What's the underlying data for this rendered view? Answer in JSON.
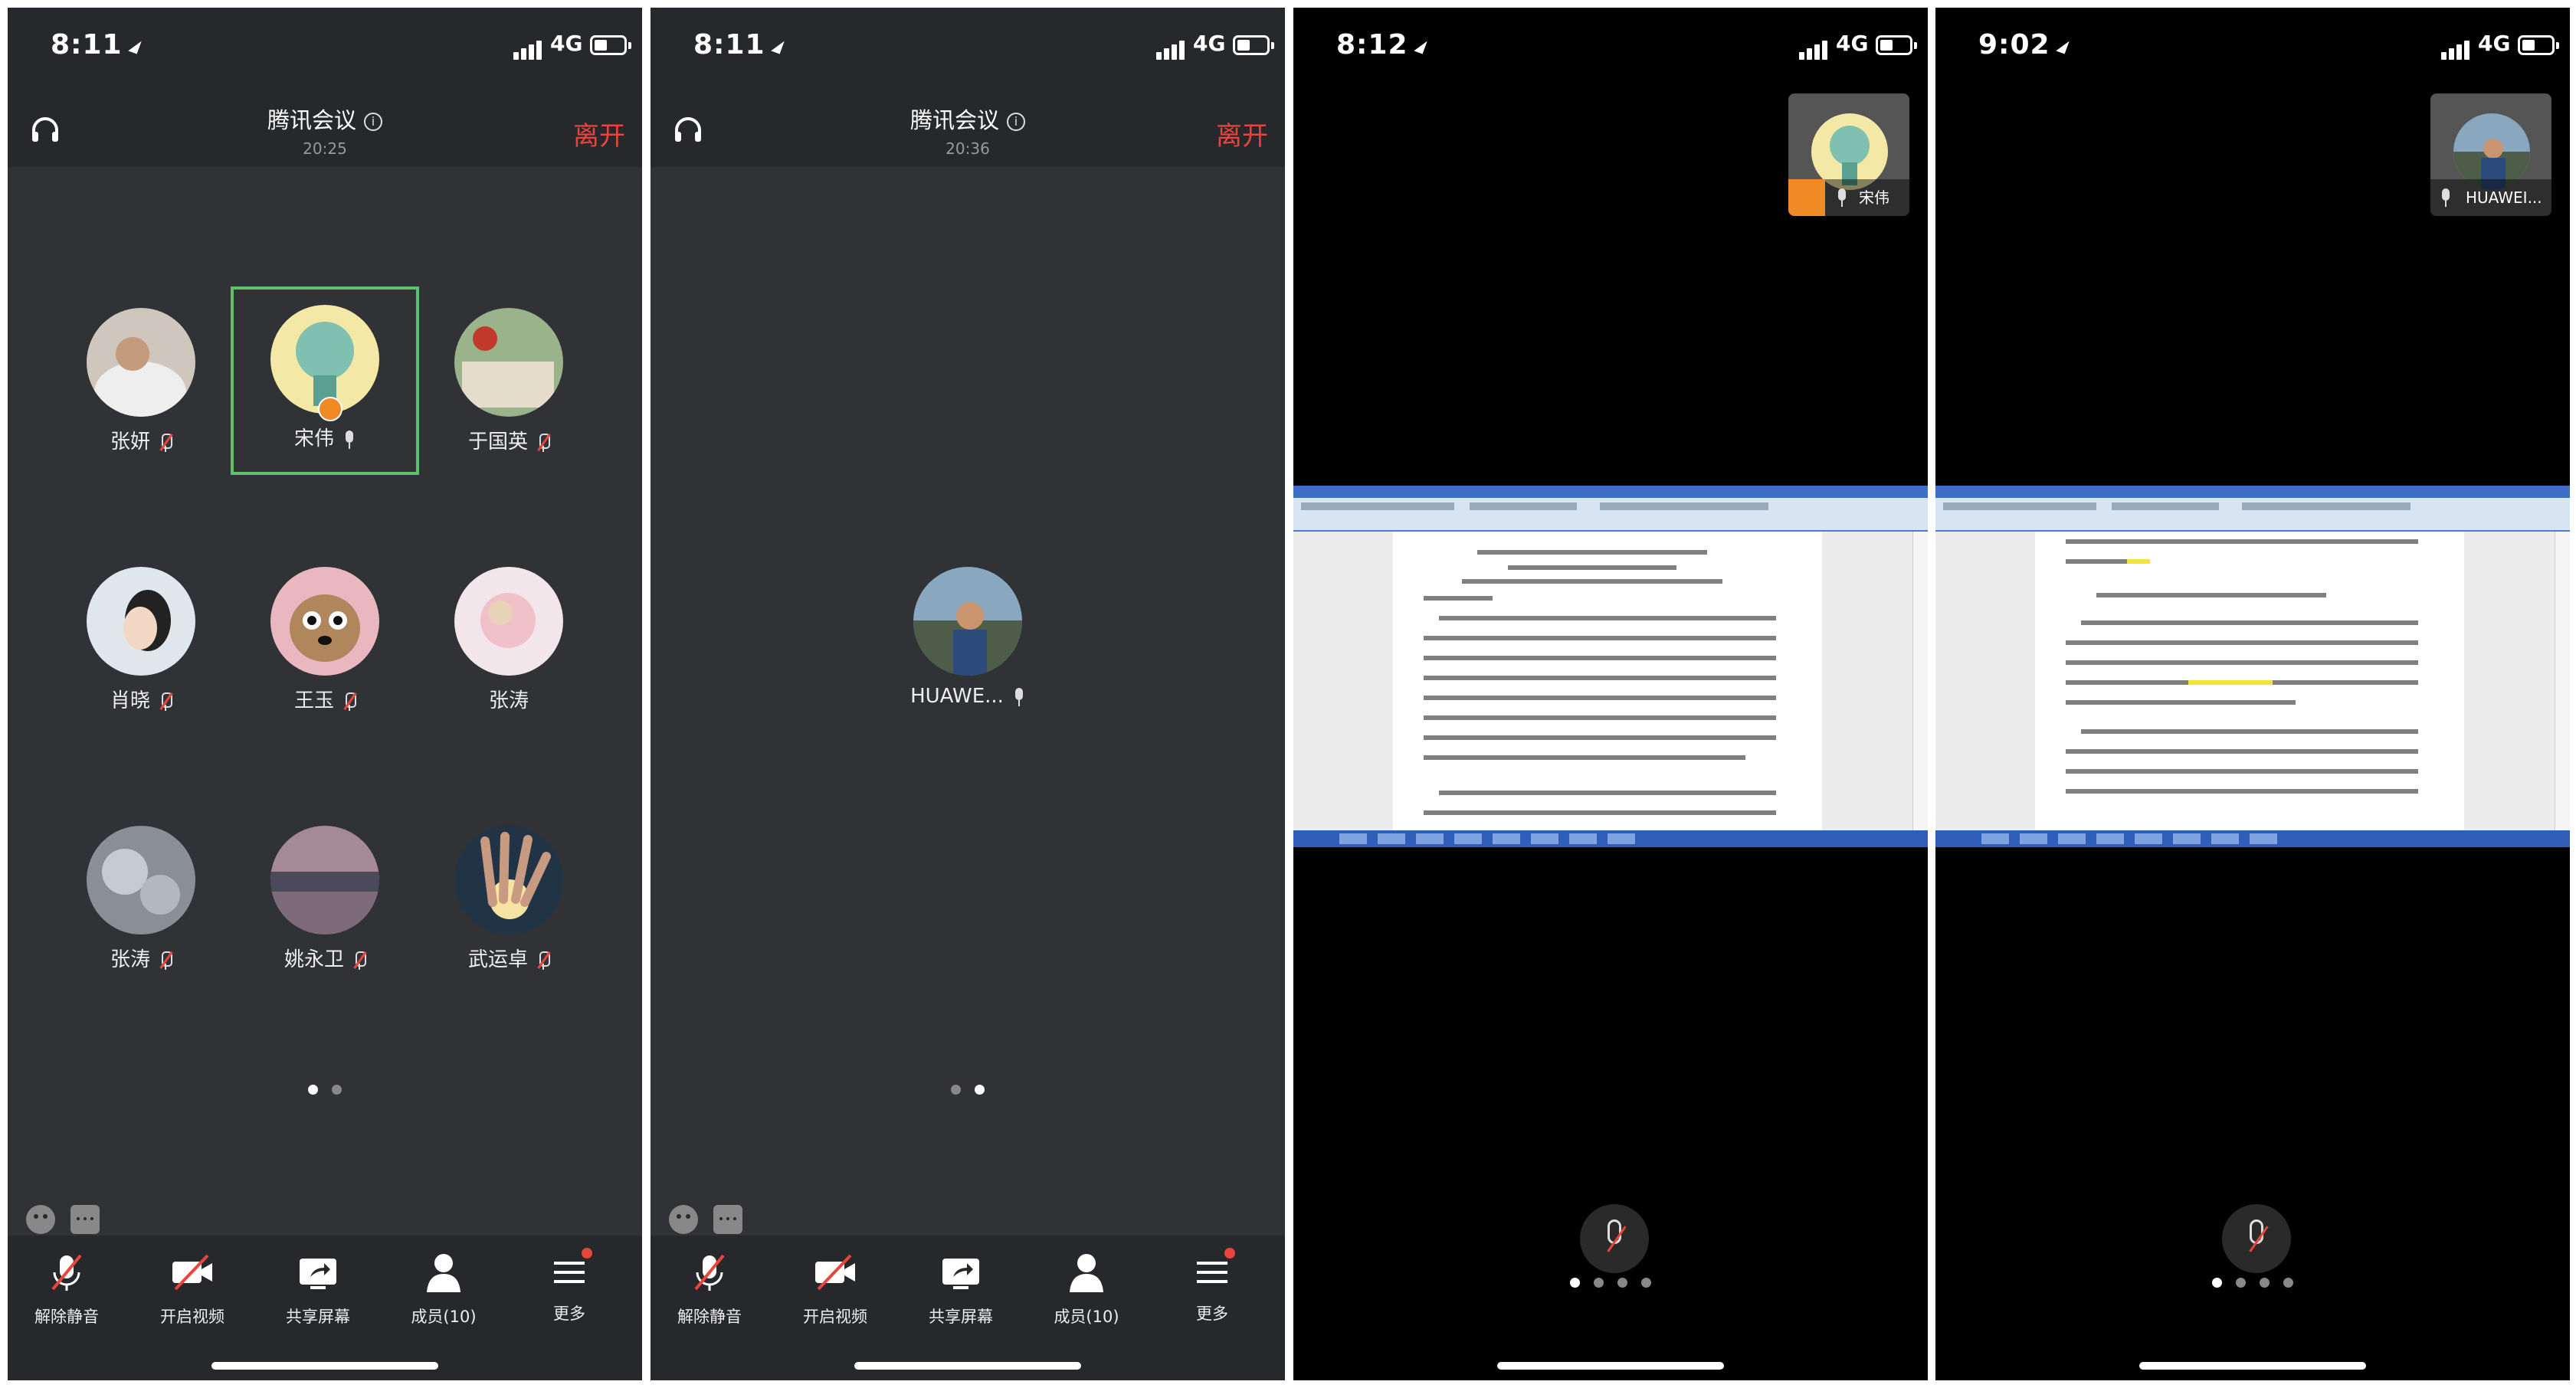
{
  "panels": [
    {
      "time": "8:11",
      "network": "4G",
      "title": "腾讯会议",
      "duration": "20:25",
      "leave": "离开",
      "participants": [
        {
          "name": "张妍",
          "mic": "muted"
        },
        {
          "name": "宋伟",
          "mic": "on",
          "active": true,
          "host": true
        },
        {
          "name": "于国英",
          "mic": "muted"
        },
        {
          "name": "肖晓",
          "mic": "muted"
        },
        {
          "name": "王玉",
          "mic": "muted"
        },
        {
          "name": "张涛",
          "mic": "none"
        },
        {
          "name": "张涛",
          "mic": "muted"
        },
        {
          "name": "姚永卫",
          "mic": "muted"
        },
        {
          "name": "武运卓",
          "mic": "muted"
        }
      ],
      "page": {
        "current": 1,
        "total": 2
      },
      "toolbar": [
        "解除静音",
        "开启视频",
        "共享屏幕",
        "成员(10)",
        "更多"
      ]
    },
    {
      "time": "8:11",
      "network": "4G",
      "title": "腾讯会议",
      "duration": "20:36",
      "leave": "离开",
      "participant": {
        "name": "HUAWE...",
        "mic": "on"
      },
      "page": {
        "current": 2,
        "total": 2
      },
      "toolbar": [
        "解除静音",
        "开启视频",
        "共享屏幕",
        "成员(10)",
        "更多"
      ]
    },
    {
      "time": "8:12",
      "network": "4G",
      "pip_name": "宋伟",
      "page": {
        "current": 1,
        "total": 4
      }
    },
    {
      "time": "9:02",
      "network": "4G",
      "pip_name": "HUAWEI...",
      "page": {
        "current": 1,
        "total": 4
      }
    }
  ],
  "colors": {
    "background": "#27282c",
    "grid": "#313236",
    "accent_red": "#e8453c",
    "active_border": "#5dc06b",
    "host_badge": "#f08a24"
  },
  "icons": {
    "headset": "headset-icon",
    "info": "info-icon",
    "emoji": "emoji-icon",
    "chat": "chat-icon",
    "mic_muted": "mic-muted-icon",
    "camera_off": "camera-off-icon",
    "share_screen": "share-screen-icon",
    "members": "members-icon",
    "more": "more-icon"
  }
}
